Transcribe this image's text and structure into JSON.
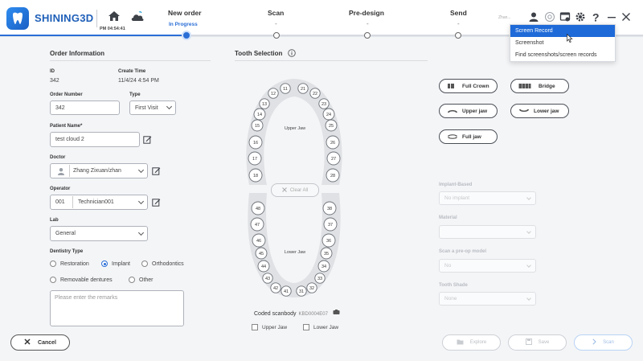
{
  "header": {
    "brand": "SHINING3D",
    "time": "PM 04:54:41",
    "user_mini": "Zhan...",
    "steps": [
      {
        "label": "New order",
        "sub": "In Progress"
      },
      {
        "label": "Scan",
        "sub": "-"
      },
      {
        "label": "Pre-design",
        "sub": "-"
      },
      {
        "label": "Send",
        "sub": "-"
      }
    ]
  },
  "dropdown": {
    "items": [
      "Screen Record",
      "Screenshot",
      "Find screenshots/screen records"
    ]
  },
  "order": {
    "title": "Order Information",
    "id_label": "ID",
    "id_value": "342",
    "create_label": "Create Time",
    "create_value": "11/4/24 4:54 PM",
    "number_label": "Order Number",
    "number_value": "342",
    "type_label": "Type",
    "type_value": "First Visit",
    "patient_label": "Patient Name*",
    "patient_value": "test cloud 2",
    "doctor_label": "Doctor",
    "doctor_value": "Zhang Zixuan/zhan",
    "operator_label": "Operator",
    "operator_id": "001",
    "operator_value": "Technician001",
    "lab_label": "Lab",
    "lab_value": "General",
    "dentistry_label": "Dentistry Type",
    "dentistry_options": [
      "Restoration",
      "Implant",
      "Orthodontics",
      "Removable dentures",
      "Other"
    ],
    "dentistry_selected": "Implant",
    "remarks_placeholder": "Please enter the remarks",
    "cancel": "Cancel"
  },
  "tooth": {
    "title": "Tooth Selection",
    "upper_label": "Upper Jaw",
    "lower_label": "Lower Jaw",
    "clear_all": "Clear All",
    "upper_teeth": [
      "18",
      "17",
      "16",
      "15",
      "14",
      "13",
      "12",
      "11",
      "21",
      "22",
      "23",
      "24",
      "25",
      "26",
      "27",
      "28"
    ],
    "lower_teeth": [
      "48",
      "47",
      "46",
      "45",
      "44",
      "43",
      "42",
      "41",
      "31",
      "32",
      "33",
      "34",
      "35",
      "36",
      "37",
      "38"
    ],
    "scanbody_label": "Coded scanbody",
    "scanbody_code": "KBD0004E07",
    "upper_jaw_check": "Upper Jaw",
    "lower_jaw_check": "Lower Jaw"
  },
  "restoration": {
    "full_crown": "Full Crown",
    "bridge": "Bridge",
    "upper_jaw": "Upper jaw",
    "lower_jaw": "Lower jaw",
    "full_jaw": "Full jaw",
    "implant_based_label": "Implant-Based",
    "implant_based_value": "No implant",
    "material_label": "Material",
    "material_value": "",
    "preop_label": "Scan a pre-op model",
    "preop_value": "No",
    "shade_label": "Tooth Shade",
    "shade_value": "None"
  },
  "footer": {
    "explore": "Explore",
    "save": "Save",
    "scan": "Scan"
  },
  "colors": {
    "accent": "#2a6ed6",
    "brand": "#1e5fb8",
    "dropdown_selected": "#1e6ad8"
  }
}
